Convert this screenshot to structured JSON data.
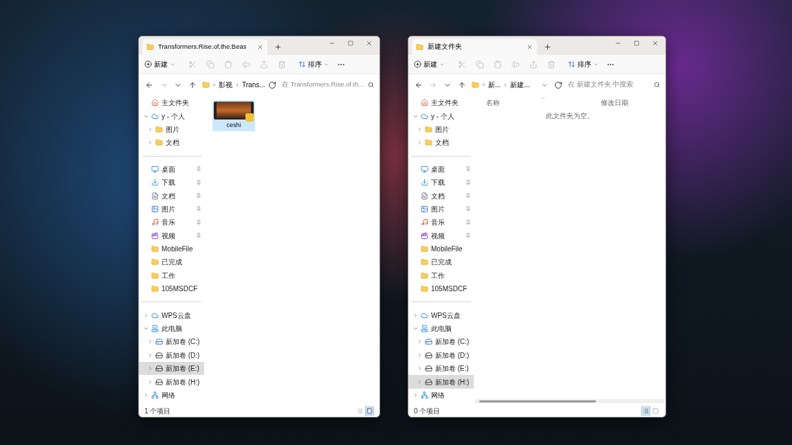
{
  "windows": [
    {
      "tab": {
        "title": "Transformers.Rise.of.the.Beas"
      },
      "toolbar": {
        "new": "新建",
        "sort": "排序"
      },
      "address": {
        "crumbs": [
          "影视",
          "Trans..."
        ],
        "search_placeholder": "在 Transformers.Rise.of.th..."
      },
      "nav": [
        [
          {
            "label": "主文件夹",
            "kind": "home"
          },
          {
            "label": "y - 个人",
            "kind": "cloud",
            "expanded": true,
            "children": [
              {
                "label": "图片",
                "kind": "folder",
                "expanded": false
              },
              {
                "label": "文档",
                "kind": "folder",
                "expanded": false
              }
            ]
          }
        ],
        [
          {
            "label": "桌面",
            "kind": "desktop",
            "pinned": true
          },
          {
            "label": "下载",
            "kind": "download",
            "pinned": true
          },
          {
            "label": "文档",
            "kind": "documents",
            "pinned": true
          },
          {
            "label": "图片",
            "kind": "pictures",
            "pinned": true
          },
          {
            "label": "音乐",
            "kind": "music",
            "pinned": true
          },
          {
            "label": "视频",
            "kind": "videos",
            "pinned": true
          },
          {
            "label": "MobileFile",
            "kind": "folder"
          },
          {
            "label": "已完成",
            "kind": "folder"
          },
          {
            "label": "工作",
            "kind": "folder"
          },
          {
            "label": "105MSDCF",
            "kind": "folder"
          }
        ],
        [
          {
            "label": "WPS云盘",
            "kind": "cloud",
            "expanded": false
          },
          {
            "label": "此电脑",
            "kind": "computer",
            "expanded": true,
            "children": [
              {
                "label": "新加卷 (C:)",
                "kind": "system-drive",
                "expanded": false,
                "selected": false
              },
              {
                "label": "新加卷 (D:)",
                "kind": "drive",
                "expanded": false,
                "selected": false
              },
              {
                "label": "新加卷 (E:)",
                "kind": "drive",
                "expanded": false,
                "selected": true
              },
              {
                "label": "新加卷 (H:)",
                "kind": "drive",
                "expanded": false,
                "selected": false
              }
            ]
          },
          {
            "label": "网络",
            "kind": "network",
            "expanded": false
          }
        ]
      ],
      "content": {
        "kind": "icons",
        "files": [
          {
            "name": "ceshi",
            "selected": true
          }
        ]
      },
      "status": "1 个项目",
      "views": [
        {
          "kind": "details",
          "selected": false
        },
        {
          "kind": "large-icons",
          "selected": true
        }
      ]
    },
    {
      "tab": {
        "title": "新建文件夹"
      },
      "toolbar": {
        "new": "新建",
        "sort": "排序"
      },
      "address": {
        "crumbs": [
          "新...",
          "新建..."
        ],
        "search_placeholder": "在 新建文件夹 中搜索"
      },
      "nav": [
        [
          {
            "label": "主文件夹",
            "kind": "home"
          },
          {
            "label": "y - 个人",
            "kind": "cloud",
            "expanded": true,
            "children": [
              {
                "label": "图片",
                "kind": "folder",
                "expanded": false
              },
              {
                "label": "文档",
                "kind": "folder",
                "expanded": false
              }
            ]
          }
        ],
        [
          {
            "label": "桌面",
            "kind": "desktop",
            "pinned": true
          },
          {
            "label": "下载",
            "kind": "download",
            "pinned": true
          },
          {
            "label": "文档",
            "kind": "documents",
            "pinned": true
          },
          {
            "label": "图片",
            "kind": "pictures",
            "pinned": true
          },
          {
            "label": "音乐",
            "kind": "music",
            "pinned": true
          },
          {
            "label": "视频",
            "kind": "videos",
            "pinned": true
          },
          {
            "label": "MobileFile",
            "kind": "folder"
          },
          {
            "label": "已完成",
            "kind": "folder"
          },
          {
            "label": "工作",
            "kind": "folder"
          },
          {
            "label": "105MSDCF",
            "kind": "folder"
          }
        ],
        [
          {
            "label": "WPS云盘",
            "kind": "cloud",
            "expanded": false
          },
          {
            "label": "此电脑",
            "kind": "computer",
            "expanded": true,
            "children": [
              {
                "label": "新加卷 (C:)",
                "kind": "system-drive",
                "expanded": false,
                "selected": false
              },
              {
                "label": "新加卷 (D:)",
                "kind": "drive",
                "expanded": false,
                "selected": false
              },
              {
                "label": "新加卷 (E:)",
                "kind": "drive",
                "expanded": false,
                "selected": false
              },
              {
                "label": "新加卷 (H:)",
                "kind": "drive",
                "expanded": false,
                "selected": true
              }
            ]
          },
          {
            "label": "网络",
            "kind": "network",
            "expanded": false
          }
        ]
      ],
      "content": {
        "kind": "details",
        "columns": [
          "名称",
          "修改日期"
        ],
        "empty_message": "此文件夹为空。"
      },
      "status": "0 个项目",
      "views": [
        {
          "kind": "details",
          "selected": true
        },
        {
          "kind": "large-icons",
          "selected": false
        }
      ]
    }
  ]
}
